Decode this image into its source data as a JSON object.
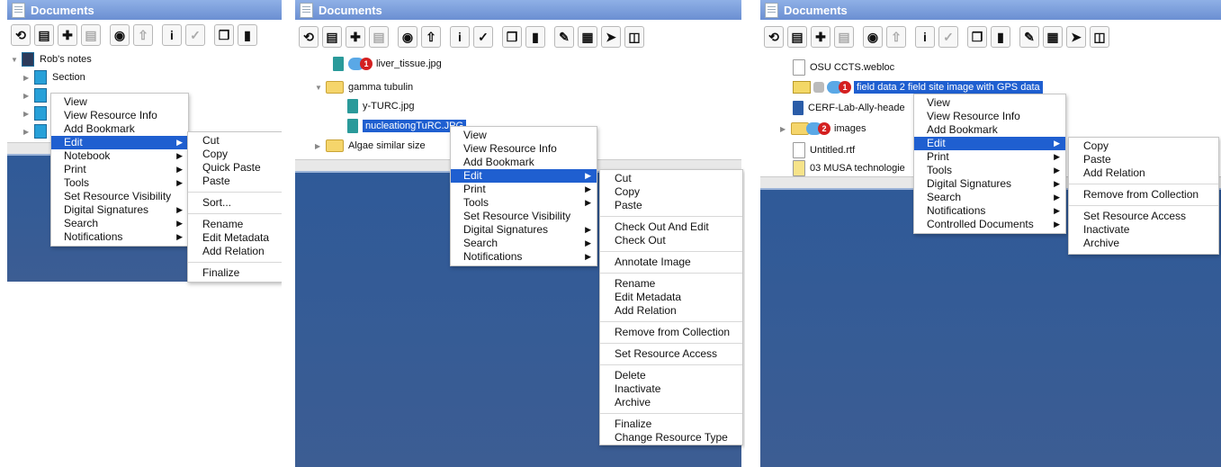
{
  "window_title": "Documents",
  "toolbar_icons": [
    "refresh-icon",
    "new-document-icon",
    "add-icon",
    "template-icon",
    "view-icon",
    "export-icon",
    "info-icon",
    "sign-icon",
    "copy-icon",
    "clipboard-icon",
    "annotate-icon",
    "pdf-icon",
    "share-icon",
    "book-icon"
  ],
  "panel1": {
    "tree": {
      "root": "Rob's notes",
      "section": "Section"
    },
    "menu": [
      "View",
      "View Resource Info",
      "Add Bookmark",
      "Edit",
      "Notebook",
      "Print",
      "Tools",
      "Set Resource Visibility",
      "Digital Signatures",
      "Search",
      "Notifications"
    ],
    "submenu": {
      "g1": [
        "Cut",
        "Copy",
        "Quick Paste",
        "Paste"
      ],
      "g2": [
        "Sort..."
      ],
      "g3": [
        "Rename",
        "Edit Metadata",
        "Add Relation"
      ],
      "g4": [
        "Finalize"
      ]
    }
  },
  "panel2": {
    "tree": {
      "liver": "liver_tissue.jpg",
      "liver_badge": "1",
      "folder": "gamma tubulin",
      "yturc": "y-TURC.jpg",
      "nucleation": "nucleationgTuRC.JPG",
      "algae": "Algae similar size"
    },
    "menu": [
      "View",
      "View Resource Info",
      "Add Bookmark",
      "Edit",
      "Print",
      "Tools",
      "Set Resource Visibility",
      "Digital Signatures",
      "Search",
      "Notifications"
    ],
    "submenu": {
      "g1": [
        "Cut",
        "Copy",
        "Paste"
      ],
      "g2": [
        "Check Out And Edit",
        "Check Out"
      ],
      "g3": [
        "Annotate Image"
      ],
      "g4": [
        "Rename",
        "Edit Metadata",
        "Add Relation"
      ],
      "g5": [
        "Remove from Collection"
      ],
      "g6": [
        "Set Resource Access"
      ],
      "g7": [
        "Delete",
        "Inactivate",
        "Archive"
      ],
      "g8": [
        "Finalize",
        "Change Resource Type"
      ]
    }
  },
  "panel3": {
    "tree": {
      "webloc": "OSU CCTS.webloc",
      "field": "field data 2 field site image with GPS data",
      "field_badge": "1",
      "cerf": "CERF-Lab-Ally-heade",
      "images": "images",
      "images_badge": "2",
      "untitled": "Untitled.rtf",
      "musa": "03 MUSA technologie"
    },
    "menu": [
      "View",
      "View Resource Info",
      "Add Bookmark",
      "Edit",
      "Print",
      "Tools",
      "Digital Signatures",
      "Search",
      "Notifications",
      "Controlled Documents"
    ],
    "submenu": {
      "g1": [
        "Copy",
        "Paste",
        "Add Relation"
      ],
      "g2": [
        "Remove from Collection"
      ],
      "g3": [
        "Set Resource Access",
        "Inactivate",
        "Archive"
      ]
    }
  },
  "colors": {
    "selection": "#1f5fd0",
    "title_bar": "#7b9ddb",
    "background_blue": "#3c5d93",
    "badge": "#d42020"
  }
}
